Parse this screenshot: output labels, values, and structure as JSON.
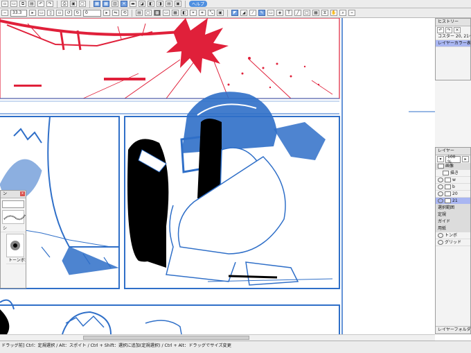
{
  "toolbar": {
    "zoom_value": "33.3",
    "rotate_value": "0",
    "help_label": "ヘルプ"
  },
  "history": {
    "title": "ヒストリー",
    "items": [
      "コスター 20, 21ペー",
      "レイヤーカラー表示"
    ]
  },
  "layers": {
    "title": "レイヤー",
    "opacity": "100 %",
    "rows": [
      "画像",
      "描き",
      "w",
      "b",
      "20",
      "21",
      "選択範囲",
      "定規",
      "ガイド",
      "用紙",
      "トンボ",
      "グリッド"
    ],
    "footer": "レイヤーフォルダ 600 c"
  },
  "brush_panel": {
    "title": "ン",
    "label": "シ",
    "tone_label": "トーンボカシ"
  },
  "status": {
    "text": "ドラッグ前] Ctrl：定規選択 / Alt：スポイト / Ctrl + Shift：選択に追加(定規選択) / Ctrl + Alt：ドラッグでサイズ変更"
  },
  "colors": {
    "red_ink": "#e0203a",
    "blue_ink": "#2f6fc8",
    "selection": "#a9b6f2"
  }
}
